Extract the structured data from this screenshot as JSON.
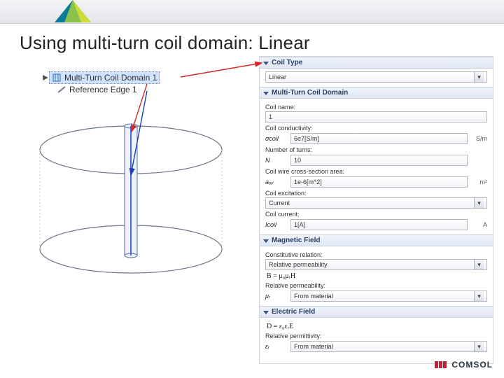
{
  "title": "Using multi-turn coil domain: Linear",
  "tree": {
    "item1_label": "Multi-Turn Coil Domain 1",
    "item2_label": "Reference Edge 1"
  },
  "panel": {
    "coil_type": {
      "heading": "Coil Type",
      "value": "Linear"
    },
    "mt": {
      "heading": "Multi-Turn Coil Domain",
      "coil_name_label": "Coil name:",
      "coil_name_value": "1",
      "conductivity_label": "Coil conductivity:",
      "cond_sym": "σcoil",
      "cond_value": "6e7[S/m]",
      "cond_unit": "S/m",
      "turns_label": "Number of turns:",
      "turns_sym": "N",
      "turns_value": "10",
      "area_label": "Coil wire cross-section area:",
      "area_sym": "aₒᵢₗ",
      "area_value": "1e-6[m^2]",
      "area_unit": "m²",
      "excitation_label": "Coil excitation:",
      "excitation_value": "Current",
      "current_label": "Coil current:",
      "current_sym": "Icoil",
      "current_value": "1[A]",
      "current_unit": "A"
    },
    "mag": {
      "heading": "Magnetic Field",
      "rel_label": "Constitutive relation:",
      "rel_value": "Relative permeability",
      "formula": "B = μ₀μᵣH",
      "perm_label": "Relative permeability:",
      "perm_sym": "μᵣ",
      "perm_value": "From material"
    },
    "elec": {
      "heading": "Electric Field",
      "formula": "D = ε₀εᵣE",
      "perm_label": "Relative permittivity:",
      "perm_sym": "εᵣ",
      "perm_value": "From material"
    }
  },
  "brand": "COMSOL"
}
